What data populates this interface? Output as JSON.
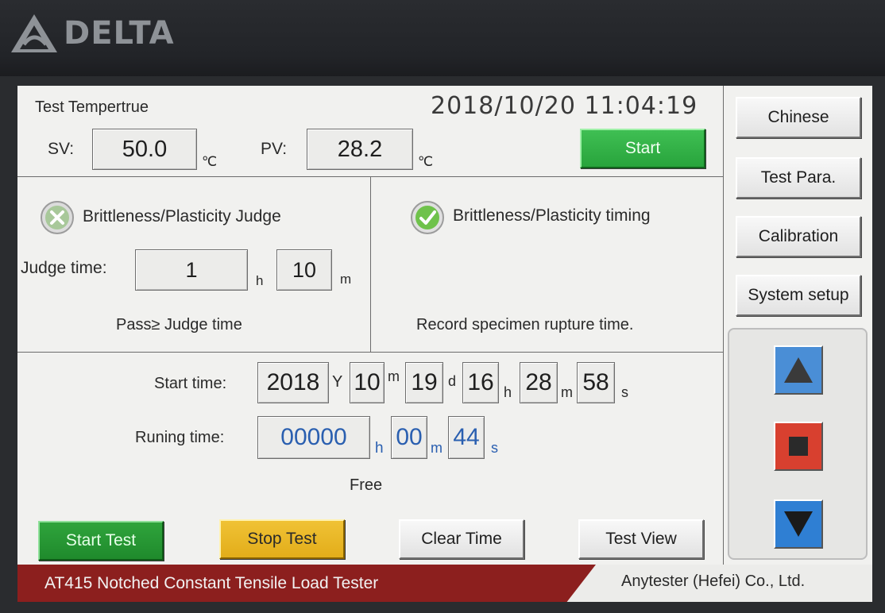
{
  "brand": {
    "logo_text": "DELTA"
  },
  "temperature": {
    "title": "Test Tempertrue",
    "datetime": "2018/10/20 11:04:19",
    "sv_label": "SV:",
    "sv_value": "50.0",
    "pv_label": "PV:",
    "pv_value": "28.2",
    "unit": "℃",
    "start_label": "Start"
  },
  "judge": {
    "title": "Brittleness/Plasticity Judge",
    "time_label": "Judge time:",
    "hours": "1",
    "hours_unit": "h",
    "minutes": "10",
    "minutes_unit": "m",
    "note": "Pass≥ Judge time"
  },
  "timing": {
    "title": "Brittleness/Plasticity timing",
    "note": "Record specimen rupture time."
  },
  "start_time": {
    "label": "Start time:",
    "year": "2018",
    "year_unit": "Y",
    "month": "10",
    "month_unit": "m",
    "day": "19",
    "day_unit": "d",
    "hour": "16",
    "hour_unit": "h",
    "minute": "28",
    "minute_unit": "m",
    "second": "58",
    "second_unit": "s"
  },
  "running_time": {
    "label": "Runing time:",
    "hours": "00000",
    "hours_unit": "h",
    "minutes": "00",
    "minutes_unit": "m",
    "seconds": "44",
    "seconds_unit": "s"
  },
  "status_text": "Free",
  "actions": {
    "start_test": "Start Test",
    "stop_test": "Stop Test",
    "clear_time": "Clear Time",
    "test_view": "Test View"
  },
  "sidebar": {
    "chinese": "Chinese",
    "test_para": "Test Para.",
    "calibration": "Calibration",
    "system_setup": "System setup"
  },
  "footer": {
    "product": "AT415 Notched Constant Tensile Load Tester",
    "company": "Anytester (Hefei) Co., Ltd."
  },
  "colors": {
    "accent_green": "#2fb144",
    "stop_yellow": "#e9b727",
    "footer_red": "#8c1f1e",
    "value_blue": "#2a5fb0"
  }
}
